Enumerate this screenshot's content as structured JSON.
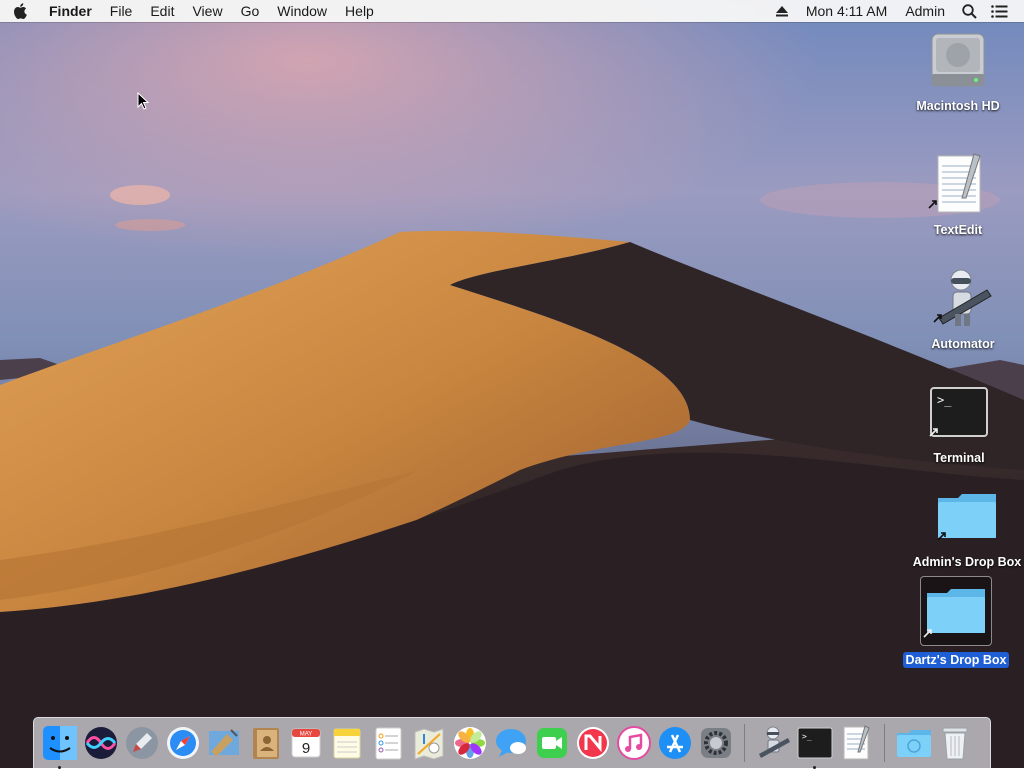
{
  "menubar": {
    "apple_icon": "apple-icon",
    "app_name": "Finder",
    "menus": [
      "File",
      "Edit",
      "View",
      "Go",
      "Window",
      "Help"
    ],
    "clock": "Mon 4:11 AM",
    "user": "Admin",
    "status_icons": [
      "eject-icon",
      "search-icon",
      "menu-list-icon"
    ]
  },
  "desktop": {
    "icons": [
      {
        "label": "Macintosh HD",
        "icon": "hard-drive-icon"
      },
      {
        "label": "TextEdit",
        "icon": "textedit-icon"
      },
      {
        "label": "Automator",
        "icon": "automator-icon"
      },
      {
        "label": "Terminal",
        "icon": "terminal-icon"
      },
      {
        "label": "Admin's Drop Box",
        "icon": "folder-icon"
      },
      {
        "label": "Dartz's Drop Box",
        "icon": "folder-icon",
        "selected": true
      }
    ]
  },
  "dock": {
    "apps": [
      {
        "name": "Finder",
        "running": true
      },
      {
        "name": "Siri"
      },
      {
        "name": "Launchpad"
      },
      {
        "name": "Safari"
      },
      {
        "name": "Mail"
      },
      {
        "name": "Contacts"
      },
      {
        "name": "Calendar",
        "month": "MAY",
        "day": "9"
      },
      {
        "name": "Notes"
      },
      {
        "name": "Reminders"
      },
      {
        "name": "Maps"
      },
      {
        "name": "Photos"
      },
      {
        "name": "Messages"
      },
      {
        "name": "FaceTime"
      },
      {
        "name": "News"
      },
      {
        "name": "iTunes"
      },
      {
        "name": "App Store"
      },
      {
        "name": "System Preferences"
      },
      {
        "name": "Automator"
      },
      {
        "name": "Terminal",
        "running": true
      },
      {
        "name": "TextEdit"
      },
      {
        "name": "Downloads"
      },
      {
        "name": "Trash"
      }
    ]
  },
  "colors": {
    "selection": "#1f5fd6",
    "folder": "#6cc6f2"
  }
}
